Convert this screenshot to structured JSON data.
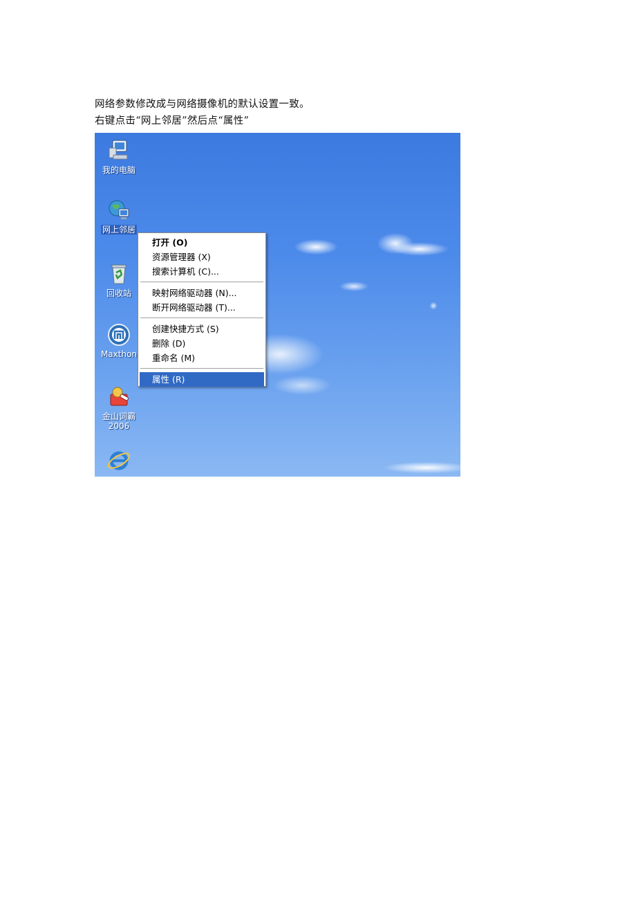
{
  "captions": [
    "网络参数修改成与网络摄像机的默认设置一致。",
    "右键点击“网上邻居”然后点“属性”"
  ],
  "desktop_icons": [
    {
      "label": "我的电脑",
      "icon": "my-computer-icon"
    },
    {
      "label": "网上邻居",
      "icon": "network-places-icon"
    },
    {
      "label": "回收站",
      "icon": "recycle-bin-icon"
    },
    {
      "label": "Maxthon",
      "icon": "maxthon-icon"
    },
    {
      "label": "金山词霸",
      "label2": "2006",
      "icon": "kingsoft-dictionary-icon"
    },
    {
      "label": "",
      "icon": "internet-explorer-icon"
    }
  ],
  "context_menu": {
    "items": [
      {
        "label": "打开 (O)",
        "bold": true
      },
      {
        "label": "资源管理器 (X)"
      },
      {
        "label": "搜索计算机 (C)..."
      },
      {
        "label": "映射网络驱动器 (N)..."
      },
      {
        "label": "断开网络驱动器 (T)..."
      },
      {
        "label": "创建快捷方式 (S)"
      },
      {
        "label": "删除 (D)"
      },
      {
        "label": "重命名 (M)"
      },
      {
        "label": "属性 (R)",
        "highlighted": true
      }
    ]
  },
  "colors": {
    "menu_highlight": "#316ac5",
    "desktop_sky": "#4c8aea"
  }
}
